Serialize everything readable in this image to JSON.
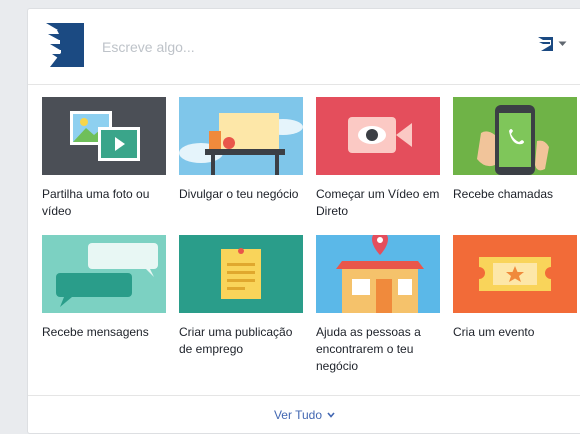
{
  "composer": {
    "placeholder": "Escreve algo...",
    "icon": "page-logo-icon",
    "audience_icon": "page-logo-icon"
  },
  "tiles": [
    {
      "label": "Partilha uma foto ou vídeo",
      "icon": "photo-video-icon",
      "bg": "#4b4f56"
    },
    {
      "label": "Divulgar o teu negócio",
      "icon": "store-counter-icon",
      "bg": "#7fc6ea"
    },
    {
      "label": "Começar um Vídeo em Direto",
      "icon": "live-video-icon",
      "bg": "#e44e5c"
    },
    {
      "label": "Recebe chamadas",
      "icon": "phone-call-icon",
      "bg": "#6fb347"
    },
    {
      "label": "Recebe mensagens",
      "icon": "chat-bubbles-icon",
      "bg": "#7cd1c2"
    },
    {
      "label": "Criar uma publicação de emprego",
      "icon": "job-note-icon",
      "bg": "#2a9d8a"
    },
    {
      "label": "Ajuda as pessoas a encontrarem o teu negócio",
      "icon": "shop-location-icon",
      "bg": "#5bb8e8"
    },
    {
      "label": "Cria um evento",
      "icon": "event-ticket-icon",
      "bg": "#f26b38"
    }
  ],
  "footer": {
    "see_all_label": "Ver Tudo"
  },
  "colors": {
    "link": "#4267b2",
    "brand": "#1b4a82"
  }
}
